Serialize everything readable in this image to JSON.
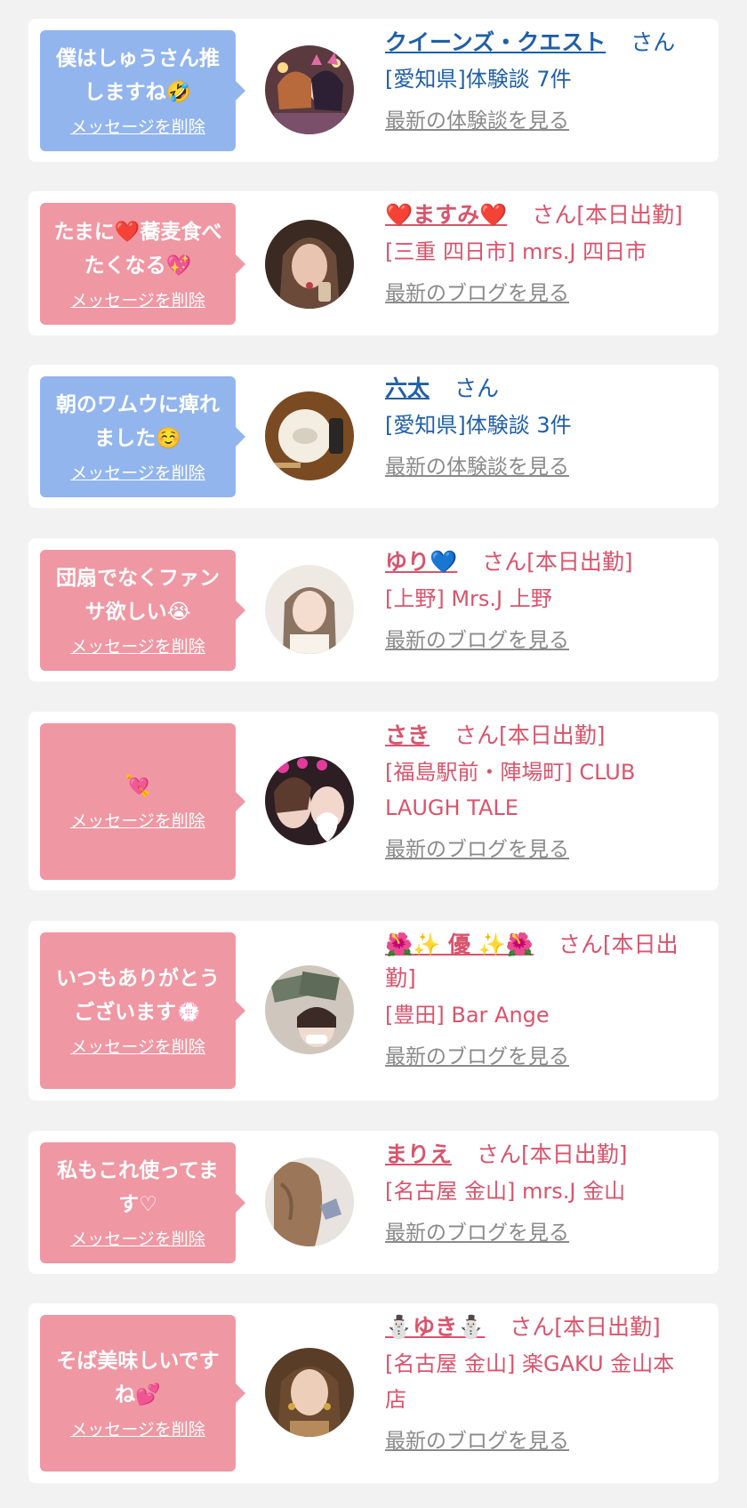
{
  "cards": [
    {
      "message": "僕はしゅうさん推しますね🤣",
      "delete_label": "メッセージを削除",
      "name": "クイーンズ・クエスト",
      "suffix": "さん",
      "detail": "[愛知県]体験談 7件",
      "link": "最新の体験談を見る",
      "avatar": "anime-girls-avatar"
    },
    {
      "message": "たまに❤️蕎麦食べたくなる💖",
      "delete_label": "メッセージを削除",
      "name": "❤️ますみ❤️",
      "suffix": "さん[本日出勤]",
      "detail": "[三重 四日市] mrs.J 四日市",
      "link": "最新のブログを見る",
      "avatar": "woman-avatar"
    },
    {
      "message": "朝のワムウに痺れました☺️",
      "delete_label": "メッセージを削除",
      "name": "六太",
      "suffix": "さん",
      "detail": "[愛知県]体験談 3件",
      "link": "最新の体験談を見る",
      "avatar": "food-table-avatar"
    },
    {
      "message": "団扇でなくファンサ欲しい😭",
      "delete_label": "メッセージを削除",
      "name": "ゆり💙",
      "suffix": "さん[本日出勤]",
      "detail": "[上野] Mrs.J 上野",
      "link": "最新のブログを見る",
      "avatar": "woman-avatar"
    },
    {
      "message": "💘",
      "delete_label": "メッセージを削除",
      "name": "さき",
      "suffix": "さん[本日出勤]",
      "detail": "[福島駅前・陣場町] CLUB LAUGH TALE",
      "link": "最新のブログを見る",
      "avatar": "women-selfie-avatar"
    },
    {
      "message": "いつもありがとうございます💮",
      "delete_label": "メッセージを削除",
      "name": "🌺✨ 優 ✨🌺",
      "suffix": "さん[本日出勤]",
      "detail": "[豊田] Bar Ange",
      "link": "最新のブログを見る",
      "avatar": "money-selfie-avatar"
    },
    {
      "message": "私もこれ使ってます♡",
      "delete_label": "メッセージを削除",
      "name": "まりえ",
      "suffix": "さん[本日出勤]",
      "detail": "[名古屋 金山] mrs.J 金山",
      "link": "最新のブログを見る",
      "avatar": "hair-avatar"
    },
    {
      "message": "そば美味しいですね💕",
      "delete_label": "メッセージを削除",
      "name": "⛄ゆき⛄",
      "suffix": "さん[本日出勤]",
      "detail": "[名古屋 金山] 楽GAKU 金山本店",
      "link": "最新のブログを見る",
      "avatar": "woman-portrait-avatar"
    }
  ],
  "colors": {
    "blue_bubble": "#93b5ee",
    "pink_bubble": "#ef97a3",
    "blue_text": "#1f5fa8",
    "pink_text": "#d8546c",
    "link_gray": "#8a8a8a"
  }
}
